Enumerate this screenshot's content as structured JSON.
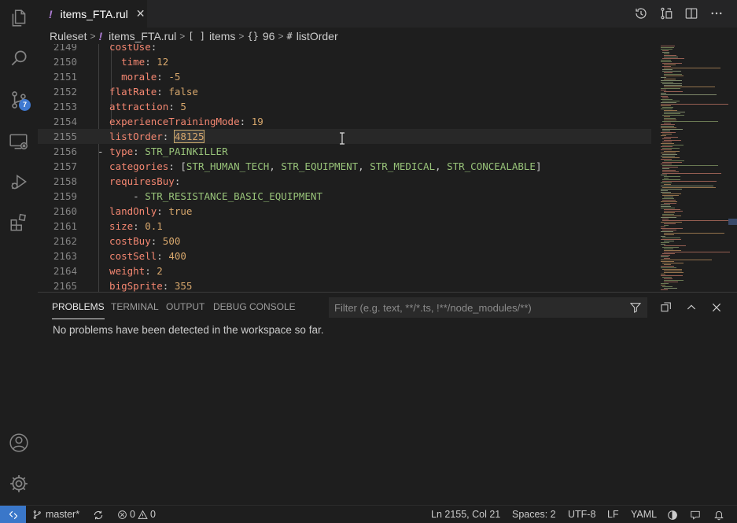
{
  "activity_bar": {
    "icons": [
      "files-icon",
      "search-icon",
      "source-control-icon",
      "remote-explorer-icon",
      "run-debug-icon",
      "extensions-icon",
      "account-icon",
      "settings-gear-icon"
    ],
    "source_control_badge": "7"
  },
  "tab": {
    "marker": "!",
    "title": "items_FTA.rul",
    "close": "✕"
  },
  "breadcrumb": {
    "items": [
      {
        "symbol": "",
        "label": "Ruleset"
      },
      {
        "symbol": "!",
        "label": "items_FTA.rul"
      },
      {
        "symbol": "[ ]",
        "label": "items"
      },
      {
        "symbol": "{}",
        "label": "96"
      },
      {
        "symbol": "#",
        "label": "listOrder"
      }
    ]
  },
  "editor": {
    "lines": [
      {
        "num": "2149",
        "indent": 2,
        "parts": [
          {
            "t": "costUse",
            "c": "k"
          },
          {
            "t": ":",
            "c": "p"
          }
        ]
      },
      {
        "num": "2150",
        "indent": 3,
        "parts": [
          {
            "t": "time",
            "c": "k"
          },
          {
            "t": ": ",
            "c": "p"
          },
          {
            "t": "12",
            "c": "n"
          }
        ]
      },
      {
        "num": "2151",
        "indent": 3,
        "parts": [
          {
            "t": "morale",
            "c": "k"
          },
          {
            "t": ": ",
            "c": "p"
          },
          {
            "t": "-5",
            "c": "n"
          }
        ]
      },
      {
        "num": "2152",
        "indent": 2,
        "parts": [
          {
            "t": "flatRate",
            "c": "k"
          },
          {
            "t": ": ",
            "c": "p"
          },
          {
            "t": "false",
            "c": "n"
          }
        ]
      },
      {
        "num": "2153",
        "indent": 2,
        "parts": [
          {
            "t": "attraction",
            "c": "k"
          },
          {
            "t": ": ",
            "c": "p"
          },
          {
            "t": "5",
            "c": "n"
          }
        ]
      },
      {
        "num": "2154",
        "indent": 2,
        "parts": [
          {
            "t": "experienceTrainingMode",
            "c": "k"
          },
          {
            "t": ": ",
            "c": "p"
          },
          {
            "t": "19",
            "c": "n"
          }
        ]
      },
      {
        "num": "2155",
        "indent": 2,
        "parts": [
          {
            "t": "listOrder",
            "c": "k"
          },
          {
            "t": ": ",
            "c": "p"
          },
          {
            "t": "48125",
            "c": "n sel"
          }
        ],
        "current": true
      },
      {
        "num": "2156",
        "indent": 1,
        "parts": [
          {
            "t": "- ",
            "c": "p"
          },
          {
            "t": "type",
            "c": "k"
          },
          {
            "t": ": ",
            "c": "p"
          },
          {
            "t": "STR_PAINKILLER",
            "c": "str"
          }
        ]
      },
      {
        "num": "2157",
        "indent": 2,
        "parts": [
          {
            "t": "categories",
            "c": "k"
          },
          {
            "t": ": [",
            "c": "p"
          },
          {
            "t": "STR_HUMAN_TECH",
            "c": "str"
          },
          {
            "t": ", ",
            "c": "p"
          },
          {
            "t": "STR_EQUIPMENT",
            "c": "str"
          },
          {
            "t": ", ",
            "c": "p"
          },
          {
            "t": "STR_MEDICAL",
            "c": "str"
          },
          {
            "t": ", ",
            "c": "p"
          },
          {
            "t": "STR_CONCEALABLE",
            "c": "str"
          },
          {
            "t": "]",
            "c": "p"
          }
        ]
      },
      {
        "num": "2158",
        "indent": 2,
        "parts": [
          {
            "t": "requiresBuy",
            "c": "k"
          },
          {
            "t": ":",
            "c": "p"
          }
        ]
      },
      {
        "num": "2159",
        "indent": 3,
        "parts": [
          {
            "t": "  - ",
            "c": "p"
          },
          {
            "t": "STR_RESISTANCE_BASIC_EQUIPMENT",
            "c": "str"
          }
        ]
      },
      {
        "num": "2160",
        "indent": 2,
        "parts": [
          {
            "t": "landOnly",
            "c": "k"
          },
          {
            "t": ": ",
            "c": "p"
          },
          {
            "t": "true",
            "c": "n"
          }
        ]
      },
      {
        "num": "2161",
        "indent": 2,
        "parts": [
          {
            "t": "size",
            "c": "k"
          },
          {
            "t": ": ",
            "c": "p"
          },
          {
            "t": "0.1",
            "c": "n"
          }
        ]
      },
      {
        "num": "2162",
        "indent": 2,
        "parts": [
          {
            "t": "costBuy",
            "c": "k"
          },
          {
            "t": ": ",
            "c": "p"
          },
          {
            "t": "500",
            "c": "n"
          }
        ]
      },
      {
        "num": "2163",
        "indent": 2,
        "parts": [
          {
            "t": "costSell",
            "c": "k"
          },
          {
            "t": ": ",
            "c": "p"
          },
          {
            "t": "400",
            "c": "n"
          }
        ]
      },
      {
        "num": "2164",
        "indent": 2,
        "parts": [
          {
            "t": "weight",
            "c": "k"
          },
          {
            "t": ": ",
            "c": "p"
          },
          {
            "t": "2",
            "c": "n"
          }
        ]
      },
      {
        "num": "2165",
        "indent": 2,
        "parts": [
          {
            "t": "bigSprite",
            "c": "k"
          },
          {
            "t": ": ",
            "c": "p"
          },
          {
            "t": "355",
            "c": "n"
          }
        ]
      }
    ]
  },
  "panel": {
    "tabs": [
      "PROBLEMS",
      "TERMINAL",
      "OUTPUT",
      "DEBUG CONSOLE"
    ],
    "active_tab": "PROBLEMS",
    "filter_placeholder": "Filter (e.g. text, **/*.ts, !**/node_modules/**)",
    "message": "No problems have been detected in the workspace so far."
  },
  "status_bar": {
    "branch": "master*",
    "errors": "0",
    "warnings": "0",
    "position": "Ln 2155, Col 21",
    "spaces": "Spaces: 2",
    "encoding": "UTF-8",
    "eol": "LF",
    "language": "YAML"
  },
  "colors": {
    "accent": "#3a77c9",
    "badge": "#3f79d1",
    "background": "#1e1e1e",
    "key": "#f48771",
    "string": "#98c379",
    "number": "#d7a76c"
  }
}
